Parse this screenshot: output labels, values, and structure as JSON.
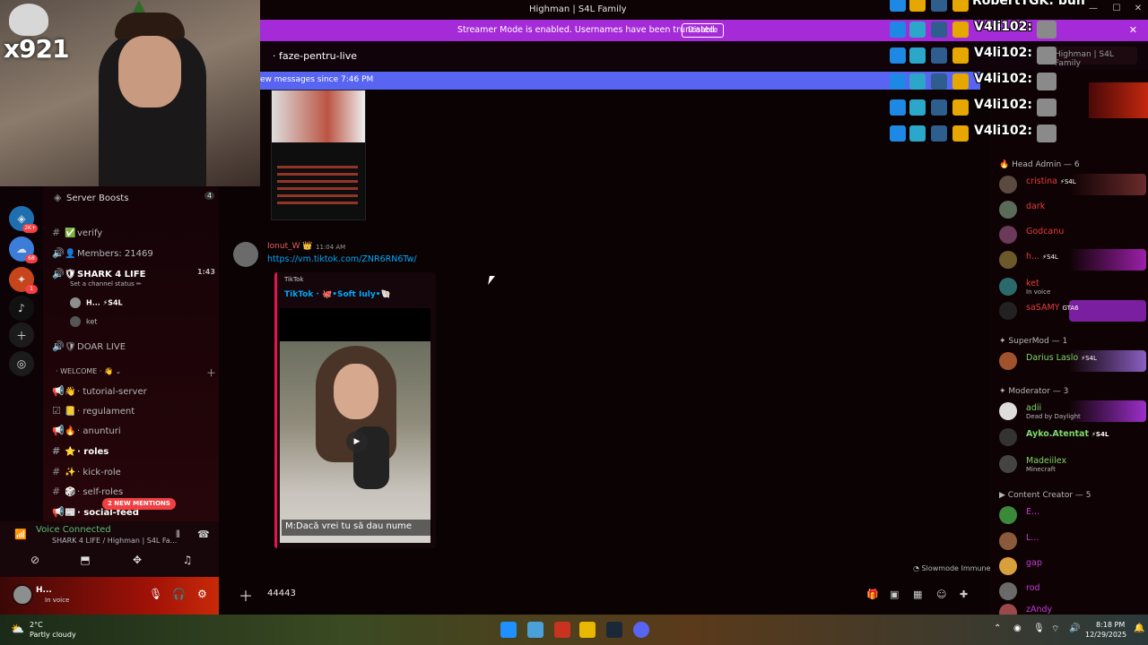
{
  "window": {
    "title": "Highman | S4L Family"
  },
  "webcam": {
    "logo_text": "x921"
  },
  "streamer_banner": {
    "message": "Streamer Mode is enabled. Usernames have been truncated.",
    "disable_label": "Disable"
  },
  "channel_header": {
    "name": "faze-pentru-live",
    "search_placeholder": "Highman | S4L Family"
  },
  "new_messages": {
    "text": "ew messages since 7:46 PM"
  },
  "server_rail": {
    "items": [
      {
        "icon": "server-icon",
        "badge": "2K+",
        "color": "#1f6fb0"
      },
      {
        "icon": "server-icon",
        "badge": "68",
        "color": "#3b7dd8"
      },
      {
        "icon": "server-icon",
        "badge": "1",
        "color": "#c7451c"
      },
      {
        "icon": "tiktok-icon",
        "badge": "",
        "color": "#111111"
      },
      {
        "icon": "add-server-icon",
        "badge": "",
        "color": "#1b1b1b"
      },
      {
        "icon": "explore-icon",
        "badge": "",
        "color": "#1b1b1b"
      }
    ]
  },
  "channels": {
    "server_boosts": {
      "label": "Server Boosts",
      "count": "4"
    },
    "items": [
      {
        "pref": "#",
        "emoji": "✅",
        "label": "verify",
        "bold": false
      },
      {
        "pref": "🔊",
        "emoji": "👤",
        "label": "Members: 21469",
        "bold": false
      },
      {
        "pref": "🔊",
        "emoji": "🛡",
        "label": "SHARK 4 LIFE",
        "bold": true,
        "time": "1:43"
      },
      {
        "pref": "",
        "emoji": "",
        "label": "Set a channel status ✏",
        "bold": false
      },
      {
        "pref": "",
        "emoji": "",
        "label": "H...   ⚡S4L",
        "bold": true
      },
      {
        "pref": "",
        "emoji": "",
        "label": "ket",
        "bold": false
      },
      {
        "pref": "🔊",
        "emoji": "🛡",
        "label": "DOAR LIVE",
        "bold": false
      },
      {
        "pref": "",
        "emoji": "",
        "label": "· WELCOME · 👋 ⌄",
        "bold": false
      },
      {
        "pref": "📢",
        "emoji": "👋",
        "label": "· tutorial-server",
        "bold": false
      },
      {
        "pref": "☑",
        "emoji": "📒",
        "label": "· regulament",
        "bold": false
      },
      {
        "pref": "📢",
        "emoji": "🔥",
        "label": "· anunturi",
        "bold": false
      },
      {
        "pref": "#",
        "emoji": "⭐",
        "label": "· roles",
        "bold": true
      },
      {
        "pref": "#",
        "emoji": "✨",
        "label": "· kick-role",
        "bold": false
      },
      {
        "pref": "#",
        "emoji": "🎲",
        "label": "· self-roles",
        "bold": false
      },
      {
        "pref": "📢",
        "emoji": "📰",
        "label": "· social-feed",
        "bold": true
      }
    ],
    "mentions_pill": "2 NEW MENTIONS"
  },
  "voice": {
    "status": "Voice Connected",
    "channel": "SHARK 4 LIFE / Highman | S4L Fa..."
  },
  "user": {
    "name": "H...",
    "status": "In voice"
  },
  "chat": {
    "message": {
      "author": "Ionut_W 👑",
      "time": "11:04 AM",
      "link": "https://vm.tiktok.com/ZNR6RN6Tw/",
      "embed_provider": "TikTok",
      "embed_title": "TikTok · 🐙•Soft Iuly•🐚",
      "subtitle": "M:Dacă vrei tu să dau nume"
    },
    "slowmode": "Slowmode Immune"
  },
  "composer": {
    "text": "44443"
  },
  "members": {
    "groups": [
      {
        "label": "Head Admin — 6"
      },
      {
        "label": "SuperMod — 1"
      },
      {
        "label": "Moderator — 3"
      },
      {
        "label": "Content Creator — 5"
      }
    ],
    "items": [
      {
        "name": "cristina",
        "tag": "⚡S4L",
        "activity": "",
        "color": "#e33d3d",
        "bg": "#6b2b2b"
      },
      {
        "name": "dark",
        "tag": "",
        "activity": "",
        "color": "#e33d3d",
        "bg": ""
      },
      {
        "name": "Godcanu",
        "tag": "",
        "activity": "",
        "color": "#e33d3d",
        "bg": ""
      },
      {
        "name": "h...",
        "tag": "⚡S4L",
        "activity": "",
        "color": "#e33d3d",
        "bg": "#9b1fa8"
      },
      {
        "name": "ket",
        "tag": "",
        "activity": "In voice",
        "color": "#e33d3d",
        "bg": ""
      },
      {
        "name": "saSAMY",
        "tag": "GTA6",
        "activity": "",
        "color": "#e33d3d",
        "bg": "#7a1fa0"
      },
      {
        "name": "Darius Laslo",
        "tag": "⚡S4L",
        "activity": "",
        "color": "#7dd96b",
        "bg": "#8a5fc2"
      },
      {
        "name": "adii",
        "tag": "",
        "activity": "Dead by Daylight",
        "color": "#7dd96b",
        "bg": "#9b2fc9"
      },
      {
        "name": "Ayko.Atentat",
        "tag": "⚡S4L",
        "activity": "",
        "color": "#7dd96b",
        "bg": ""
      },
      {
        "name": "Madeiilex",
        "tag": "",
        "activity": "Minecraft",
        "color": "#7dd96b",
        "bg": ""
      },
      {
        "name": "E...",
        "tag": "",
        "activity": "",
        "color": "#c23cd6",
        "bg": ""
      },
      {
        "name": "L...",
        "tag": "",
        "activity": "",
        "color": "#c23cd6",
        "bg": ""
      },
      {
        "name": "gap",
        "tag": "",
        "activity": "",
        "color": "#c23cd6",
        "bg": ""
      },
      {
        "name": "rod",
        "tag": "",
        "activity": "",
        "color": "#c23cd6",
        "bg": ""
      },
      {
        "name": "zAndy",
        "tag": "",
        "activity": "",
        "color": "#c23cd6",
        "bg": ""
      }
    ]
  },
  "overlay": {
    "rows": [
      {
        "name": "RobertTGK: bun"
      },
      {
        "name": "V4li102:"
      },
      {
        "name": "V4li102:"
      },
      {
        "name": "V4li102:"
      },
      {
        "name": "V4li102:"
      },
      {
        "name": "V4li102:"
      }
    ]
  },
  "taskbar": {
    "temp": "2°C",
    "weather": "Partly cloudy",
    "time": "8:18 PM",
    "date": "12/29/2025"
  }
}
